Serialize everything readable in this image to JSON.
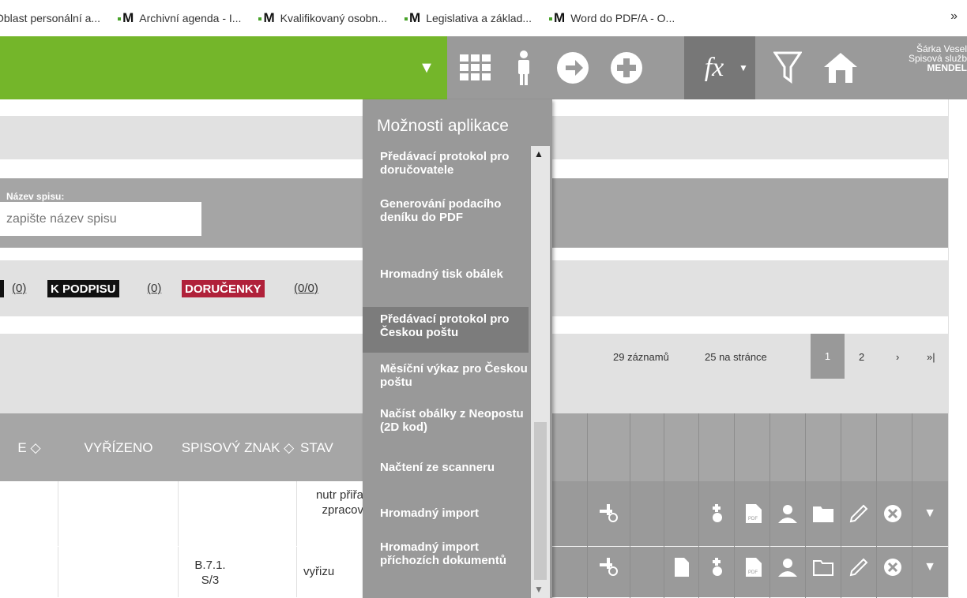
{
  "bookmarks": {
    "items": [
      {
        "label": "Oblast personální a..."
      },
      {
        "label": "Archivní agenda - I..."
      },
      {
        "label": "Kvalifikovaný osobn..."
      },
      {
        "label": "Legislativa a základ..."
      },
      {
        "label": "Word do PDF/A - O..."
      }
    ],
    "more": "»"
  },
  "toolbar": {
    "accent": "#74b62a",
    "dropdown_arrow": "▼",
    "icons": [
      "grid-icon",
      "person-icon",
      "arrow-right-circle-icon",
      "plus-circle-icon",
      "function-icon",
      "filter-icon",
      "home-icon"
    ],
    "fx_label": "fx",
    "fx_arrow": "▼",
    "user": {
      "name": "Šárka Vesel",
      "role": "Spisová služb",
      "org": "MENDEL"
    }
  },
  "form": {
    "nazev_label": "Název spisu:",
    "nazev_placeholder": "zapište název spisu"
  },
  "tags": {
    "first_count": "(0)",
    "k_podpisu": "K PODPISU",
    "k_podpisu_count": "(0)",
    "dorucenky": "DORUČENKY",
    "dorucenky_count": "(0/0)",
    "dorucenky_color": "#b0213a"
  },
  "pagination": {
    "records": "29 záznamů",
    "per_page": "25 na stránce",
    "page1": "1",
    "page2": "2",
    "next": "›",
    "last": "»|"
  },
  "table": {
    "headers": {
      "col_e": "E ◇",
      "vyrizeno": "VYŘÍZENO",
      "spisovy_znak": "SPISOVÝ ZNAK ◇",
      "stav": "STAV"
    },
    "rows": [
      {
        "spisovy_znak": "",
        "stav": "nutr přiřa zpracov"
      },
      {
        "spisovy_znak": "B.7.1. S/3",
        "stav": "vyřizu"
      }
    ]
  },
  "menu": {
    "title": "Možnosti aplikace",
    "items": [
      {
        "label": "Předávací protokol pro doručovatele"
      },
      {
        "label": "Generování podacího deníku do PDF"
      },
      {
        "label": "Hromadný tisk obálek"
      },
      {
        "label": "Předávací protokol pro Českou poštu"
      },
      {
        "label": "Měsíční výkaz pro Českou poštu"
      },
      {
        "label": "Načíst obálky z Neopostu (2D kod)"
      },
      {
        "label": "Načtení ze scanneru"
      },
      {
        "label": "Hromadný import"
      },
      {
        "label": "Hromadný import příchozích dokumentů"
      }
    ]
  }
}
